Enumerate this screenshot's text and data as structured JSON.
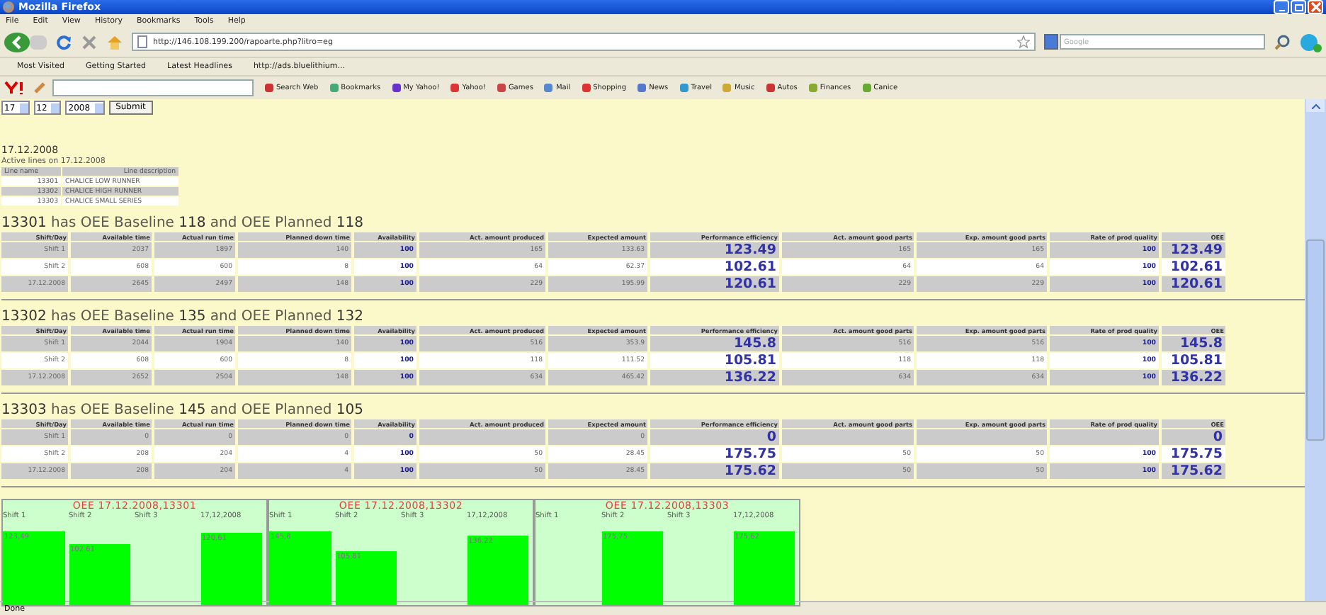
{
  "window": {
    "title": "Mozilla Firefox"
  },
  "menu": [
    "File",
    "Edit",
    "View",
    "History",
    "Bookmarks",
    "Tools",
    "Help"
  ],
  "address": {
    "value": "http://146.108.199.200/rapoarte.php?litro=eg"
  },
  "search": {
    "placeholder": "Google"
  },
  "bookmarks": [
    "Most Visited",
    "Getting Started",
    "Latest Headlines",
    "http://ads.bluelithium..."
  ],
  "yahoo_toolbar": [
    "Search Web",
    "Bookmarks",
    "My Yahoo!",
    "Yahoo!",
    "Games",
    "Mail",
    "Shopping",
    "News",
    "Travel",
    "Music",
    "Autos",
    "Finances",
    "Canice"
  ],
  "date_form": {
    "day": "17",
    "month": "12",
    "year": "2008",
    "submit": "Submit"
  },
  "date": "17.12.2008",
  "active_lines": {
    "title": "Active lines on 17.12.2008",
    "columns": [
      "Line name",
      "Line description"
    ],
    "rows": [
      [
        "13301",
        "CHALICE LOW RUNNER"
      ],
      [
        "13302",
        "CHALICE HIGH RUNNER"
      ],
      [
        "13303",
        "CHALICE SMALL SERIES"
      ]
    ]
  },
  "lines": [
    {
      "heading": "**13301** has OEE Baseline **118** and OEE Planned **118**",
      "columns": [
        {
          "label": "Shift/Day",
          "kind": "text"
        },
        {
          "label": "Available time",
          "kind": "num"
        },
        {
          "label": "Actual run time",
          "kind": "num"
        },
        {
          "label": "Planned down time",
          "kind": "num"
        },
        {
          "label": "Availability",
          "kind": "flag"
        },
        {
          "label": "Act. amount produced",
          "kind": "num"
        },
        {
          "label": "Expected amount",
          "kind": "num"
        },
        {
          "label": "Performance efficiency",
          "kind": "big"
        },
        {
          "label": "Act. amount good parts",
          "kind": "num"
        },
        {
          "label": "Exp. amount good parts",
          "kind": "num"
        },
        {
          "label": "Rate of prod quality",
          "kind": "flag"
        },
        {
          "label": "OEE",
          "kind": "big"
        }
      ],
      "rows": [
        [
          "Shift 1",
          "2037",
          "1897",
          "140",
          "100",
          "165",
          "133.63",
          "123.49",
          "165",
          "165",
          "100",
          "123.49"
        ],
        [
          "Shift 2",
          "608",
          "600",
          "8",
          "100",
          "64",
          "62.37",
          "102.61",
          "64",
          "64",
          "100",
          "102.61"
        ],
        [
          "17.12.2008",
          "2645",
          "2497",
          "148",
          "100",
          "229",
          "195.99",
          "120.61",
          "229",
          "229",
          "100",
          "120.61"
        ]
      ]
    },
    {
      "heading": "**13302** has OEE Baseline **135** and OEE Planned **132**",
      "columns": [
        {
          "label": "Shift/Day",
          "kind": "text"
        },
        {
          "label": "Available time",
          "kind": "num"
        },
        {
          "label": "Actual run time",
          "kind": "num"
        },
        {
          "label": "Planned down time",
          "kind": "num"
        },
        {
          "label": "Availability",
          "kind": "flag"
        },
        {
          "label": "Act. amount produced",
          "kind": "num"
        },
        {
          "label": "Expected amount",
          "kind": "num"
        },
        {
          "label": "Performance efficiency",
          "kind": "big"
        },
        {
          "label": "Act. amount good parts",
          "kind": "num"
        },
        {
          "label": "Exp. amount good parts",
          "kind": "num"
        },
        {
          "label": "Rate of prod quality",
          "kind": "flag"
        },
        {
          "label": "OEE",
          "kind": "big"
        }
      ],
      "rows": [
        [
          "Shift 1",
          "2044",
          "1904",
          "140",
          "100",
          "516",
          "353.9",
          "145.8",
          "516",
          "516",
          "100",
          "145.8"
        ],
        [
          "Shift 2",
          "608",
          "600",
          "8",
          "100",
          "118",
          "111.52",
          "105.81",
          "118",
          "118",
          "100",
          "105.81"
        ],
        [
          "17.12.2008",
          "2652",
          "2504",
          "148",
          "100",
          "634",
          "465.42",
          "136.22",
          "634",
          "634",
          "100",
          "136.22"
        ]
      ]
    },
    {
      "heading": "**13303** has OEE Baseline **145** and OEE Planned **105**",
      "columns": [
        {
          "label": "Shift/Day",
          "kind": "text"
        },
        {
          "label": "Available time",
          "kind": "num"
        },
        {
          "label": "Actual run time",
          "kind": "num"
        },
        {
          "label": "Planned down time",
          "kind": "num"
        },
        {
          "label": "Availability",
          "kind": "flag"
        },
        {
          "label": "Act. amount produced",
          "kind": "num"
        },
        {
          "label": "Expected amount",
          "kind": "num"
        },
        {
          "label": "Performance efficiency",
          "kind": "big"
        },
        {
          "label": "Act. amount good parts",
          "kind": "num"
        },
        {
          "label": "Exp. amount good parts",
          "kind": "num"
        },
        {
          "label": "Rate of prod quality",
          "kind": "flag"
        },
        {
          "label": "OEE",
          "kind": "big"
        }
      ],
      "rows": [
        [
          "Shift 1",
          "0",
          "0",
          "0",
          "0",
          null,
          "0",
          "0",
          null,
          null,
          null,
          "0"
        ],
        [
          "Shift 2",
          "208",
          "204",
          "4",
          "100",
          "50",
          "28.45",
          "175.75",
          "50",
          "50",
          "100",
          "175.75"
        ],
        [
          "17.12.2008",
          "208",
          "204",
          "4",
          "100",
          "50",
          "28.45",
          "175.62",
          "50",
          "50",
          "100",
          "175.62"
        ]
      ]
    }
  ],
  "charts": [
    {
      "chart_data": {
        "type": "bar",
        "title": "OEE 17.12.2008,13301",
        "categories": [
          "Shift 1",
          "Shift 2",
          "Shift 3",
          "17,12,2008"
        ],
        "values": [
          123.49,
          102.61,
          null,
          120.61
        ],
        "value_labels": [
          "123,49",
          "102,61",
          null,
          "120,61"
        ]
      }
    },
    {
      "chart_data": {
        "type": "bar",
        "title": "OEE 17.12.2008,13302",
        "categories": [
          "Shift 1",
          "Shift 2",
          "Shift 3",
          "17,12,2008"
        ],
        "values": [
          145.8,
          105.81,
          null,
          136.22
        ],
        "value_labels": [
          "145,8",
          "105,81",
          null,
          "136,22"
        ]
      }
    },
    {
      "chart_data": {
        "type": "bar",
        "title": "OEE 17.12.2008,13303",
        "categories": [
          "Shift 1",
          "Shift 2",
          "Shift 3",
          "17,12,2008"
        ],
        "values": [
          null,
          175.75,
          null,
          175.62
        ],
        "value_labels": [
          null,
          "175,75",
          null,
          "175,62"
        ]
      }
    }
  ],
  "status_bar": "Done"
}
